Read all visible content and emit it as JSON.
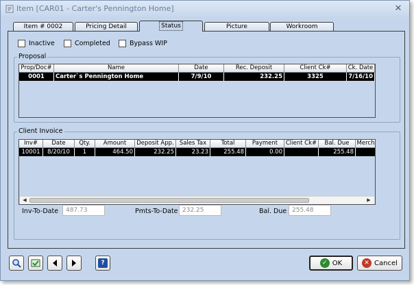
{
  "window": {
    "title": "Item [CAR01 - Carter's Pennington Home]"
  },
  "tabs": [
    {
      "label": "Item # 0002"
    },
    {
      "label": "Pricing Detail"
    },
    {
      "label": "Status"
    },
    {
      "label": "Picture"
    },
    {
      "label": "Workroom"
    }
  ],
  "active_tab": "Status",
  "checkboxes": [
    {
      "label": "Inactive",
      "checked": false
    },
    {
      "label": "Completed",
      "checked": false
    },
    {
      "label": "Bypass WIP",
      "checked": false
    }
  ],
  "proposal": {
    "label": "Proposal",
    "columns": [
      "Prop/Doc#",
      "Name",
      "Date",
      "Rec. Deposit",
      "Client Ck#",
      "Ck. Date"
    ],
    "rows": [
      [
        "0001",
        "Carter`s Pennington Home",
        "7/9/10",
        "232.25",
        "3325",
        "7/16/10"
      ]
    ]
  },
  "client_invoice": {
    "label": "Client Invoice",
    "columns": [
      "Inv#",
      "Date",
      "Qty.",
      "Amount",
      "Deposit App.",
      "Sales Tax",
      "Total",
      "Payment",
      "Client Ck#",
      "Bal. Due",
      "Merch"
    ],
    "rows": [
      [
        "10001",
        "8/20/10",
        "1",
        "464.50",
        "232.25",
        "23.23",
        "255.48",
        "0.00",
        "",
        "255.48",
        ""
      ]
    ]
  },
  "totals": {
    "inv_to_date_label": "Inv-To-Date",
    "inv_to_date": "487.73",
    "pmts_to_date_label": "Pmts-To-Date",
    "pmts_to_date": "232.25",
    "bal_due_label": "Bal. Due",
    "bal_due": "255.48"
  },
  "footer": {
    "ok_label": "OK",
    "cancel_label": "Cancel"
  },
  "colors": {
    "window_bg": "#c5d6ec",
    "selected_row": "#000000",
    "ok_icon": "#2e8b2e",
    "cancel_icon": "#c0392b",
    "help_icon": "#1f4fa3"
  }
}
